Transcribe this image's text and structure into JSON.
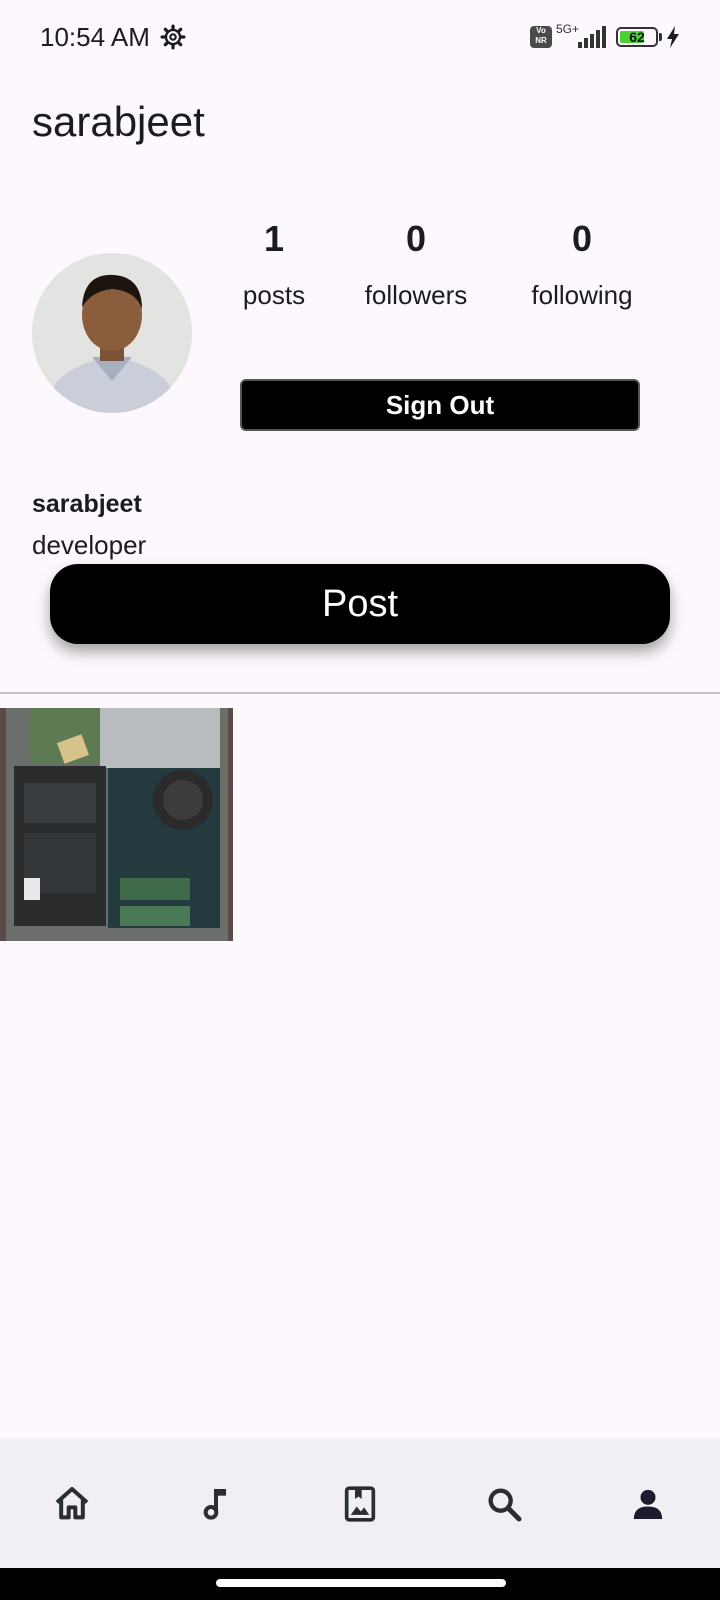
{
  "status_bar": {
    "time": "10:54 AM",
    "volte": "Vo NR",
    "network": "5G+",
    "battery": "62"
  },
  "profile": {
    "username": "sarabjeet",
    "posts_count": "1",
    "posts_label": "posts",
    "followers_count": "0",
    "followers_label": "followers",
    "following_count": "0",
    "following_label": "following",
    "sign_out_label": "Sign Out",
    "bio_name": "sarabjeet",
    "bio_text": "developer",
    "post_button_label": "Post"
  },
  "bottom_nav": {
    "items": [
      {
        "icon": "home-icon"
      },
      {
        "icon": "music-note-icon"
      },
      {
        "icon": "gallery-icon"
      },
      {
        "icon": "search-icon"
      },
      {
        "icon": "person-icon"
      }
    ]
  },
  "colors": {
    "background": "#fdf8fd",
    "button": "#000000",
    "nav_background": "#f1eff5",
    "text": "#1c1b1f"
  }
}
